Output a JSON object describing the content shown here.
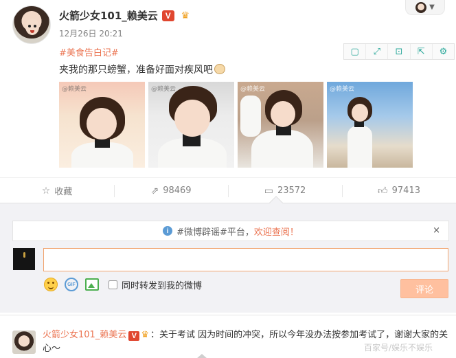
{
  "post": {
    "author": "火箭少女101_赖美云",
    "verified_badge": "V",
    "time": "12月26日 20:21",
    "hashtag": "#美食告白记#",
    "text": "夹我的那只螃蟹，准备好面对疾风吧",
    "photo_count": 4,
    "photo_watermark": "@赖美云",
    "toolbar_icons": [
      "frame-icon",
      "expand-icon",
      "save-icon",
      "share-icon",
      "settings-icon"
    ]
  },
  "actions": {
    "favorite_label": "收藏",
    "repost_count": "98469",
    "comment_count": "23572",
    "like_count": "97413"
  },
  "comment_box": {
    "notice_hashtag": "#微博辟谣#平台，",
    "notice_link": "欢迎查阅！",
    "close": "×",
    "input_value": "",
    "repost_label": "同时转发到我的微博",
    "submit_label": "评论",
    "gif_label": "GIF"
  },
  "top_comment": {
    "author": "火箭少女101_赖美云",
    "verified_badge": "V",
    "text": "：关于考试 因为时间的冲突，所以今年没办法按参加考试了，谢谢大家的关心～"
  },
  "watermark": "百家号/娱乐不娱乐",
  "colors": {
    "accent": "#eb7350",
    "toolbar_icon": "#2aa89a",
    "verified": "#e0462f",
    "panel_bg": "#f2f2f5"
  }
}
